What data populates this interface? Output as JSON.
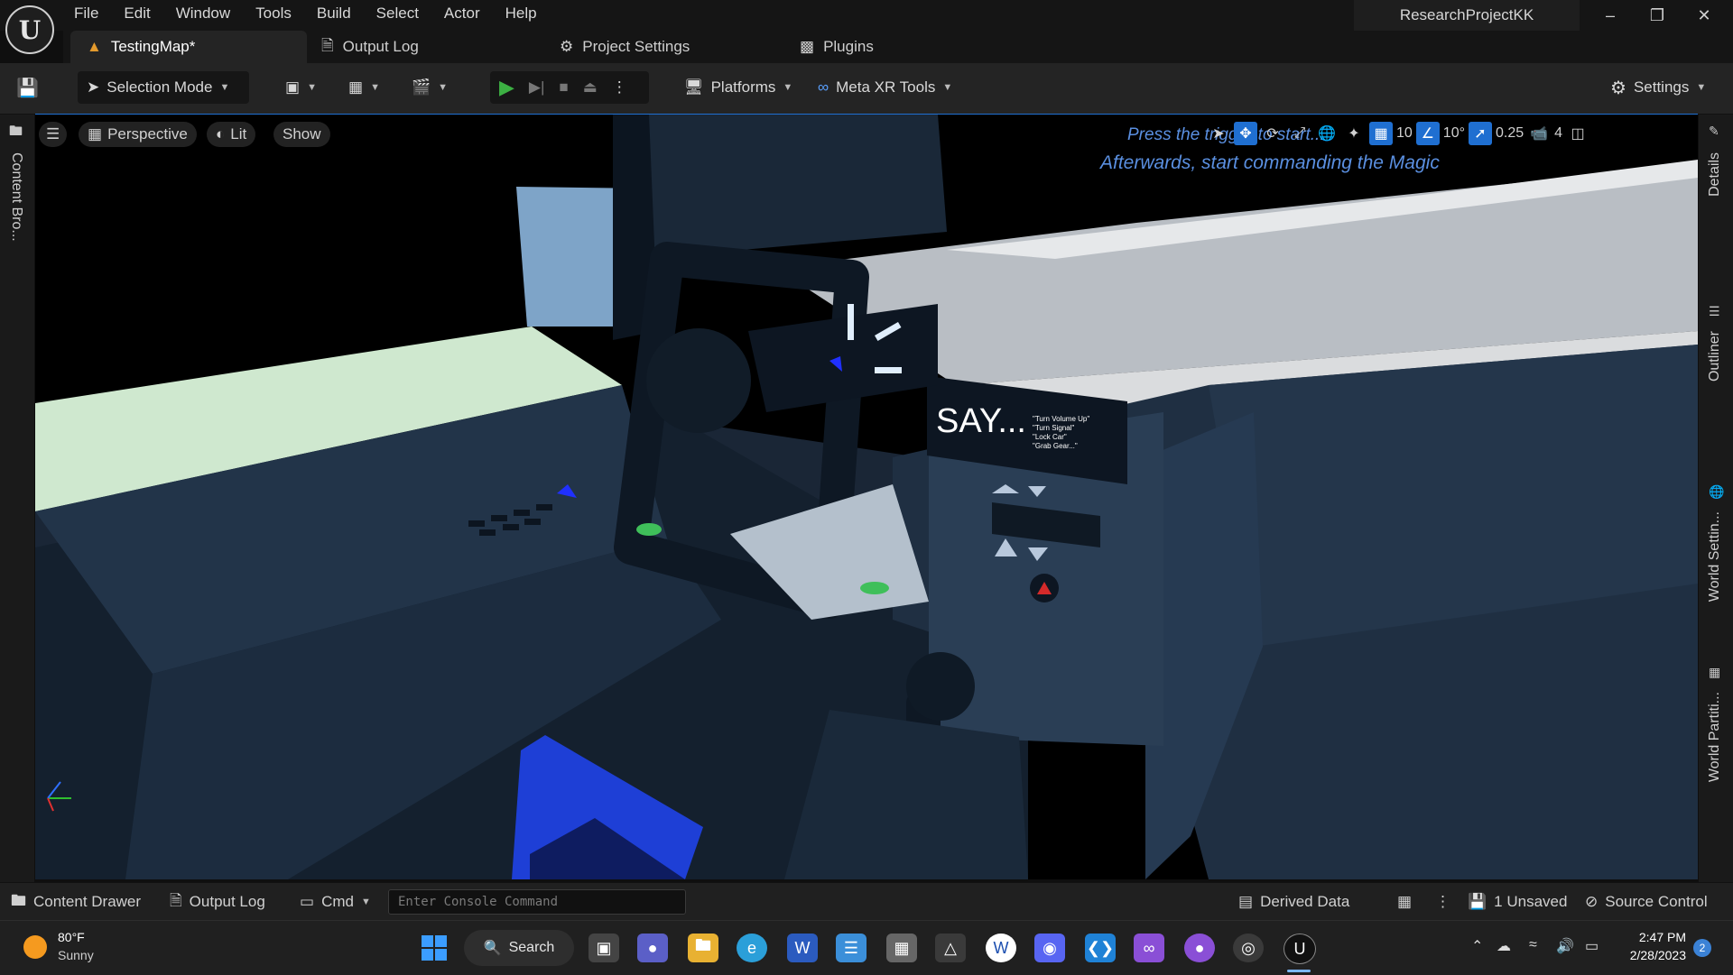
{
  "window": {
    "project_name": "ResearchProjectKK",
    "menu": [
      "File",
      "Edit",
      "Window",
      "Tools",
      "Build",
      "Select",
      "Actor",
      "Help"
    ]
  },
  "tabs": [
    {
      "label": "TestingMap*",
      "active": true
    },
    {
      "label": "Output Log"
    },
    {
      "label": "Project Settings"
    },
    {
      "label": "Plugins"
    }
  ],
  "toolbar": {
    "mode": "Selection Mode",
    "platforms": "Platforms",
    "meta_xr": "Meta XR Tools",
    "settings": "Settings"
  },
  "viewport": {
    "perspective": "Perspective",
    "lit": "Lit",
    "show": "Show",
    "grid_snap": "10",
    "rotation_snap": "10°",
    "scale_snap": "0.25",
    "camera_speed": "4",
    "overlay_line1": "Press the trigger to start...",
    "overlay_line2": "Afterwards, start commanding the Magic",
    "say_title": "SAY...",
    "say_commands": [
      "\"Turn Volume Up\"",
      "\"Turn Signal\"",
      "\"Lock Car\"",
      "\"Grab Gear...\""
    ]
  },
  "side_panels": {
    "left": "Content Bro...",
    "right": [
      "Details",
      "Outliner",
      "World Settin...",
      "World Partiti..."
    ]
  },
  "bottom_bar": {
    "content_drawer": "Content Drawer",
    "output_log": "Output Log",
    "cmd": "Cmd",
    "console_placeholder": "Enter Console Command",
    "derived_data": "Derived Data",
    "unsaved": "1 Unsaved",
    "source_control": "Source Control"
  },
  "taskbar": {
    "weather_temp": "80°F",
    "weather_desc": "Sunny",
    "search": "Search",
    "time": "2:47 PM",
    "date": "2/28/2023",
    "notifications": "2"
  },
  "colors": {
    "accent": "#1f6fd1",
    "play": "#3cb043"
  }
}
